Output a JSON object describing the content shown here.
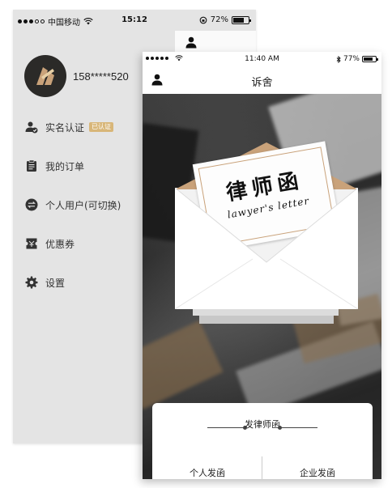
{
  "back_phone": {
    "status_bar": {
      "carrier": "中国移动",
      "time": "15:12",
      "battery": "72%",
      "battery_level": 0.72
    },
    "profile": {
      "phone_number": "158*****520"
    },
    "menu": [
      {
        "label": "实名认证",
        "icon": "user-verified-icon",
        "badge": "已认证"
      },
      {
        "label": "我的订单",
        "icon": "clipboard-icon"
      },
      {
        "label": "个人用户(可切换)",
        "icon": "switch-arrows-icon"
      },
      {
        "label": "优惠券",
        "icon": "coupon-icon"
      },
      {
        "label": "设置",
        "icon": "gear-icon"
      }
    ]
  },
  "front_phone": {
    "status_bar": {
      "time": "11:40 AM",
      "battery": "77%",
      "battery_level": 0.77
    },
    "nav": {
      "title": "诉舍"
    },
    "letter": {
      "title": "律师函",
      "subtitle": "lawyer's letter"
    },
    "action_card": {
      "heading": "发律师函",
      "buttons": {
        "personal": "个人发函",
        "enterprise": "企业发函"
      }
    }
  },
  "colors": {
    "accent_gold": "#d8b678",
    "envelope_tan": "#c9a27a",
    "dark": "#2b2a28"
  }
}
